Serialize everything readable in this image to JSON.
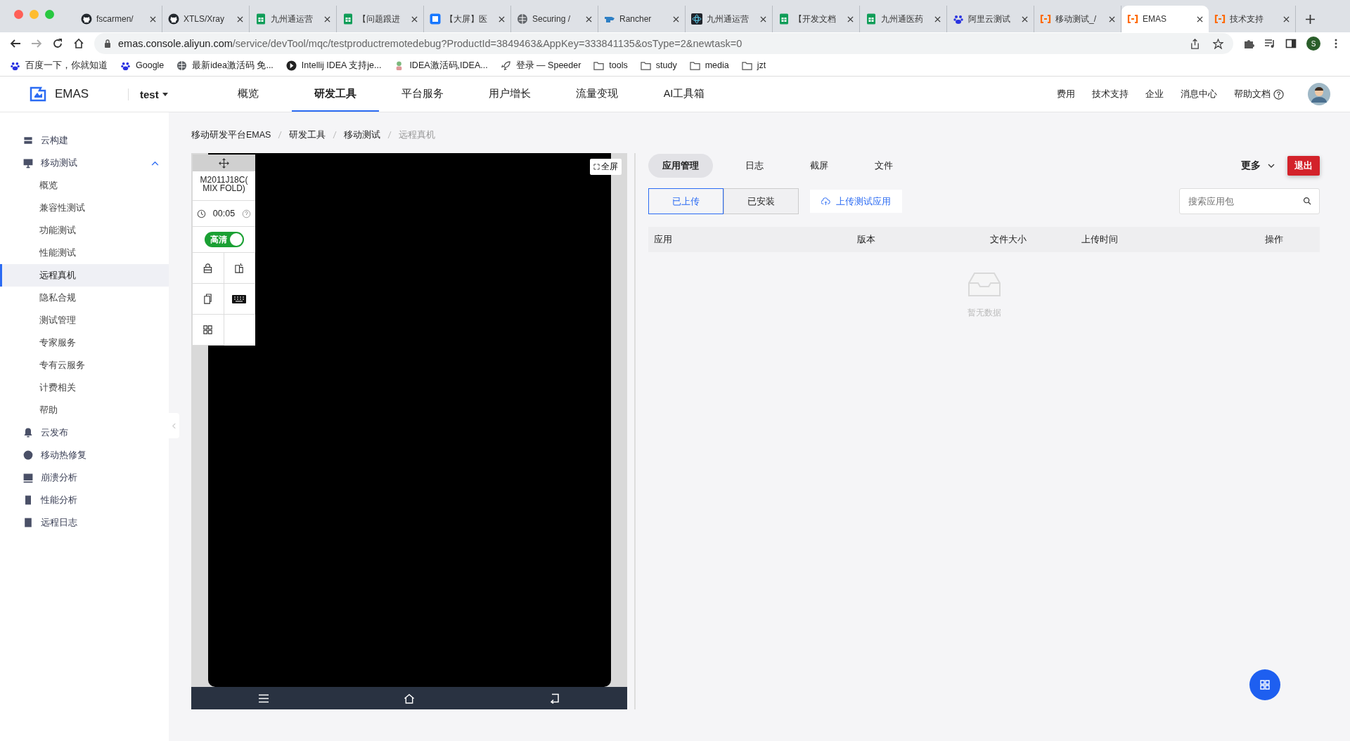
{
  "browser": {
    "tabs": [
      {
        "kind": "github",
        "title": "fscarmen/",
        "selected": false
      },
      {
        "kind": "github",
        "title": "XTLS/Xray",
        "selected": false
      },
      {
        "kind": "sheet",
        "title": "九州通运营",
        "selected": false
      },
      {
        "kind": "sheet",
        "title": "【问题跟进",
        "selected": false
      },
      {
        "kind": "app",
        "title": "【大屏】医",
        "selected": false
      },
      {
        "kind": "globe",
        "title": "Securing /",
        "selected": false
      },
      {
        "kind": "rancher",
        "title": "Rancher",
        "selected": false
      },
      {
        "kind": "react",
        "title": "九州通运营",
        "selected": false
      },
      {
        "kind": "sheet",
        "title": "【开发文档",
        "selected": false
      },
      {
        "kind": "sheet",
        "title": "九州通医药",
        "selected": false
      },
      {
        "kind": "baidu",
        "title": "阿里云测试",
        "selected": false
      },
      {
        "kind": "aliyun",
        "title": "移动测试_/",
        "selected": false
      },
      {
        "kind": "aliyun",
        "title": "EMAS",
        "selected": true
      },
      {
        "kind": "aliyun",
        "title": "技术支持",
        "selected": false
      }
    ],
    "url_host": "emas.console.aliyun.com",
    "url_path": "/service/devTool/mqc/testproductremotedebug?ProductId=3849463&AppKey=333841135&osType=2&newtask=0",
    "profile_initial": "S",
    "bookmarks": [
      {
        "kind": "baidu",
        "label": "百度一下，你就知道"
      },
      {
        "kind": "baidu",
        "label": "Google"
      },
      {
        "kind": "globe",
        "label": "最新idea激活码 免..."
      },
      {
        "kind": "intellij",
        "label": "Intellij IDEA 支持je..."
      },
      {
        "kind": "figure",
        "label": "IDEA激活码,IDEA..."
      },
      {
        "kind": "rocket",
        "label": "登录 — Speeder"
      },
      {
        "kind": "folder",
        "label": "tools"
      },
      {
        "kind": "folder",
        "label": "study"
      },
      {
        "kind": "folder",
        "label": "media"
      },
      {
        "kind": "folder",
        "label": "jzt"
      }
    ]
  },
  "header": {
    "logo": "EMAS",
    "project": "test",
    "nav": [
      {
        "label": "概览",
        "selected": false
      },
      {
        "label": "研发工具",
        "selected": true
      },
      {
        "label": "平台服务",
        "selected": false
      },
      {
        "label": "用户增长",
        "selected": false
      },
      {
        "label": "流量变现",
        "selected": false
      },
      {
        "label": "AI工具箱",
        "selected": false
      }
    ],
    "links": [
      "费用",
      "技术支持",
      "企业",
      "消息中心",
      "帮助文档"
    ]
  },
  "sidebar": {
    "items": [
      {
        "label": "云构建"
      },
      {
        "label": "移动测试",
        "children": [
          {
            "label": "概览",
            "selected": false
          },
          {
            "label": "兼容性测试",
            "selected": false
          },
          {
            "label": "功能测试",
            "selected": false
          },
          {
            "label": "性能测试",
            "selected": false
          },
          {
            "label": "远程真机",
            "selected": true
          },
          {
            "label": "隐私合规",
            "selected": false
          },
          {
            "label": "测试管理",
            "selected": false
          },
          {
            "label": "专家服务",
            "selected": false
          },
          {
            "label": "专有云服务",
            "selected": false
          },
          {
            "label": "计费相关",
            "selected": false
          },
          {
            "label": "帮助",
            "selected": false
          }
        ]
      },
      {
        "label": "云发布"
      },
      {
        "label": "移动热修复"
      },
      {
        "label": "崩溃分析"
      },
      {
        "label": "性能分析"
      },
      {
        "label": "远程日志"
      }
    ]
  },
  "breadcrumb": [
    "移动研发平台EMAS",
    "研发工具",
    "移动测试",
    "远程真机"
  ],
  "device": {
    "model": "M2011J18C( MIX FOLD)",
    "timer": "00:05",
    "hd": {
      "label": "高清",
      "on": true
    },
    "fullscreen": "全屏"
  },
  "panel": {
    "tabs": [
      {
        "label": "应用管理",
        "selected": true
      },
      {
        "label": "日志",
        "selected": false
      },
      {
        "label": "截屏",
        "selected": false
      },
      {
        "label": "文件",
        "selected": false
      }
    ],
    "more": "更多",
    "exit": "退出",
    "segments": [
      {
        "label": "已上传",
        "selected": true
      },
      {
        "label": "已安装",
        "selected": false
      }
    ],
    "upload": "上传测试应用",
    "search_placeholder": "搜索应用包",
    "columns": [
      "应用",
      "版本",
      "文件大小",
      "上传时间",
      "操作"
    ],
    "empty": "暂无数据"
  }
}
